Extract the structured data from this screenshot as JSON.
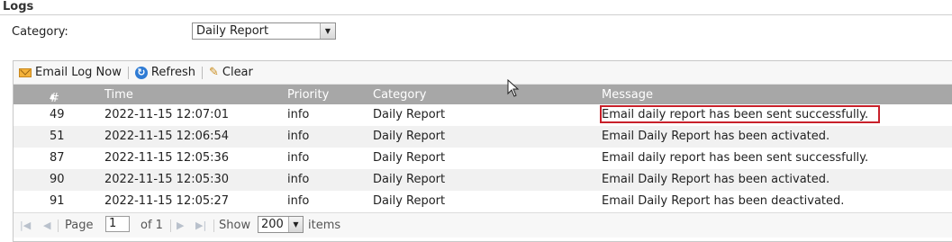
{
  "section": {
    "title": "Logs"
  },
  "filter": {
    "label": "Category:",
    "selected": "Daily Report"
  },
  "toolbar": {
    "email_label": "Email Log Now",
    "refresh_label": "Refresh",
    "clear_label": "Clear"
  },
  "columns": {
    "num": "#",
    "time": "Time",
    "priority": "Priority",
    "category": "Category",
    "message": "Message"
  },
  "rows": [
    {
      "num": "49",
      "time": "2022-11-15 12:07:01",
      "priority": "info",
      "category": "Daily Report",
      "message": "Email daily report has been sent successfully."
    },
    {
      "num": "51",
      "time": "2022-11-15 12:06:54",
      "priority": "info",
      "category": "Daily Report",
      "message": "Email Daily Report has been activated."
    },
    {
      "num": "87",
      "time": "2022-11-15 12:05:36",
      "priority": "info",
      "category": "Daily Report",
      "message": "Email daily report has been sent successfully."
    },
    {
      "num": "90",
      "time": "2022-11-15 12:05:30",
      "priority": "info",
      "category": "Daily Report",
      "message": "Email Daily Report has been activated."
    },
    {
      "num": "91",
      "time": "2022-11-15 12:05:27",
      "priority": "info",
      "category": "Daily Report",
      "message": "Email Daily Report has been deactivated."
    }
  ],
  "pager": {
    "page_label": "Page",
    "page_value": "1",
    "of_label": "of 1",
    "show_label": "Show",
    "page_size": "200",
    "items_label": "items"
  },
  "colors": {
    "header_bg": "#a7a7a7",
    "highlight": "#c8202a",
    "alt_row": "#f1f1f1"
  }
}
